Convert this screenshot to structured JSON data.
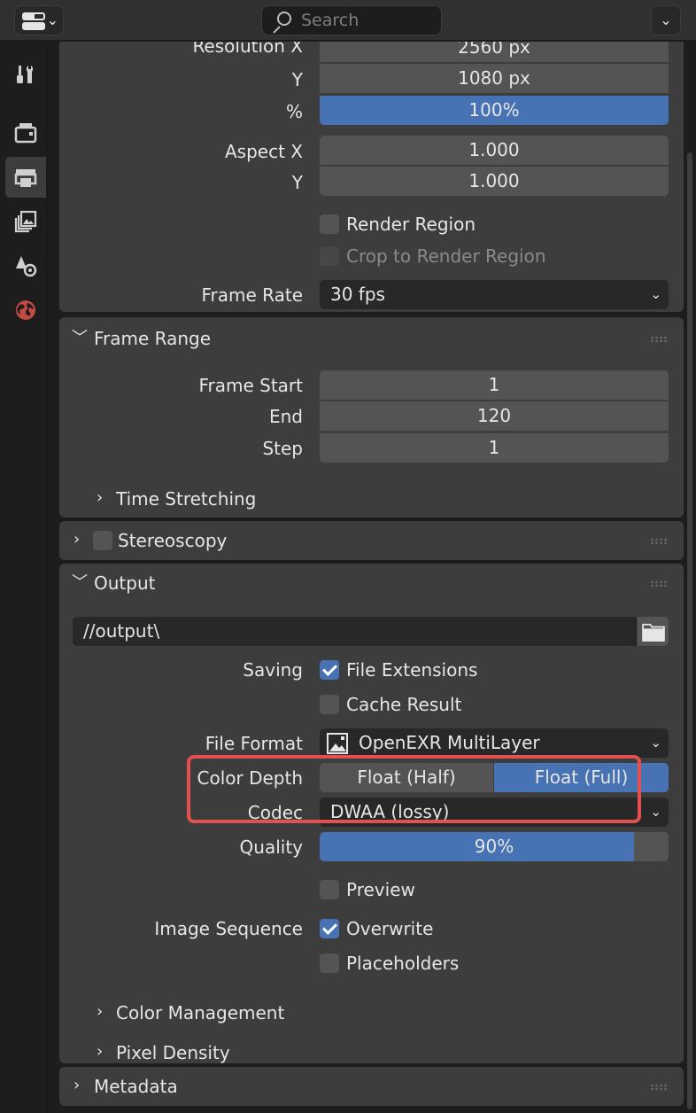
{
  "header": {
    "search_placeholder": "Search",
    "editor_type_icon": "properties-editor-icon",
    "dropdown_glyph": "⌄"
  },
  "tabs": [
    {
      "name": "tool-tab",
      "icon": "wrench-screwdriver-icon",
      "active": false
    },
    {
      "name": "render-tab",
      "icon": "camera-back-icon",
      "active": false
    },
    {
      "name": "output-tab",
      "icon": "printer-icon",
      "active": true
    },
    {
      "name": "view-layer-tab",
      "icon": "images-stack-icon",
      "active": false
    },
    {
      "name": "scene-tab",
      "icon": "cone-sphere-icon",
      "active": false
    },
    {
      "name": "world-tab",
      "icon": "globe-icon",
      "active": false
    }
  ],
  "format": {
    "resolution_x_label": "Resolution X",
    "resolution_x_value": "2560 px",
    "y_label": "Y",
    "resolution_y_value": "1080 px",
    "percent_label": "%",
    "percent_value": "100%",
    "aspect_x_label": "Aspect X",
    "aspect_x_value": "1.000",
    "aspect_y_label": "Y",
    "aspect_y_value": "1.000",
    "render_region_label": "Render Region",
    "render_region_checked": false,
    "crop_label": "Crop to Render Region",
    "crop_checked": false,
    "frame_rate_label": "Frame Rate",
    "frame_rate_value": "30 fps"
  },
  "frame_range": {
    "title": "Frame Range",
    "start_label": "Frame Start",
    "start_value": "1",
    "end_label": "End",
    "end_value": "120",
    "step_label": "Step",
    "step_value": "1",
    "time_stretching_label": "Time Stretching"
  },
  "stereoscopy": {
    "title": "Stereoscopy",
    "enabled": false
  },
  "output": {
    "title": "Output",
    "path_value": "//output\\",
    "saving_label": "Saving",
    "file_extensions_label": "File Extensions",
    "file_extensions_checked": true,
    "cache_result_label": "Cache Result",
    "cache_result_checked": false,
    "file_format_label": "File Format",
    "file_format_value": "OpenEXR MultiLayer",
    "color_depth_label": "Color Depth",
    "color_depth_options": [
      "Float (Half)",
      "Float (Full)"
    ],
    "color_depth_selected": "Float (Full)",
    "codec_label": "Codec",
    "codec_value": "DWAA (lossy)",
    "quality_label": "Quality",
    "quality_value": "90%",
    "quality_fraction": 0.9,
    "preview_label": "Preview",
    "preview_checked": false,
    "image_sequence_label": "Image Sequence",
    "overwrite_label": "Overwrite",
    "overwrite_checked": true,
    "placeholders_label": "Placeholders",
    "placeholders_checked": false,
    "color_management_label": "Color Management",
    "pixel_density_label": "Pixel Density"
  },
  "metadata": {
    "title": "Metadata"
  },
  "colors": {
    "accent_blue": "#4772b3",
    "highlight_red": "#e45050",
    "panel_bg": "#3d3d3d",
    "field_bg": "#545454"
  }
}
